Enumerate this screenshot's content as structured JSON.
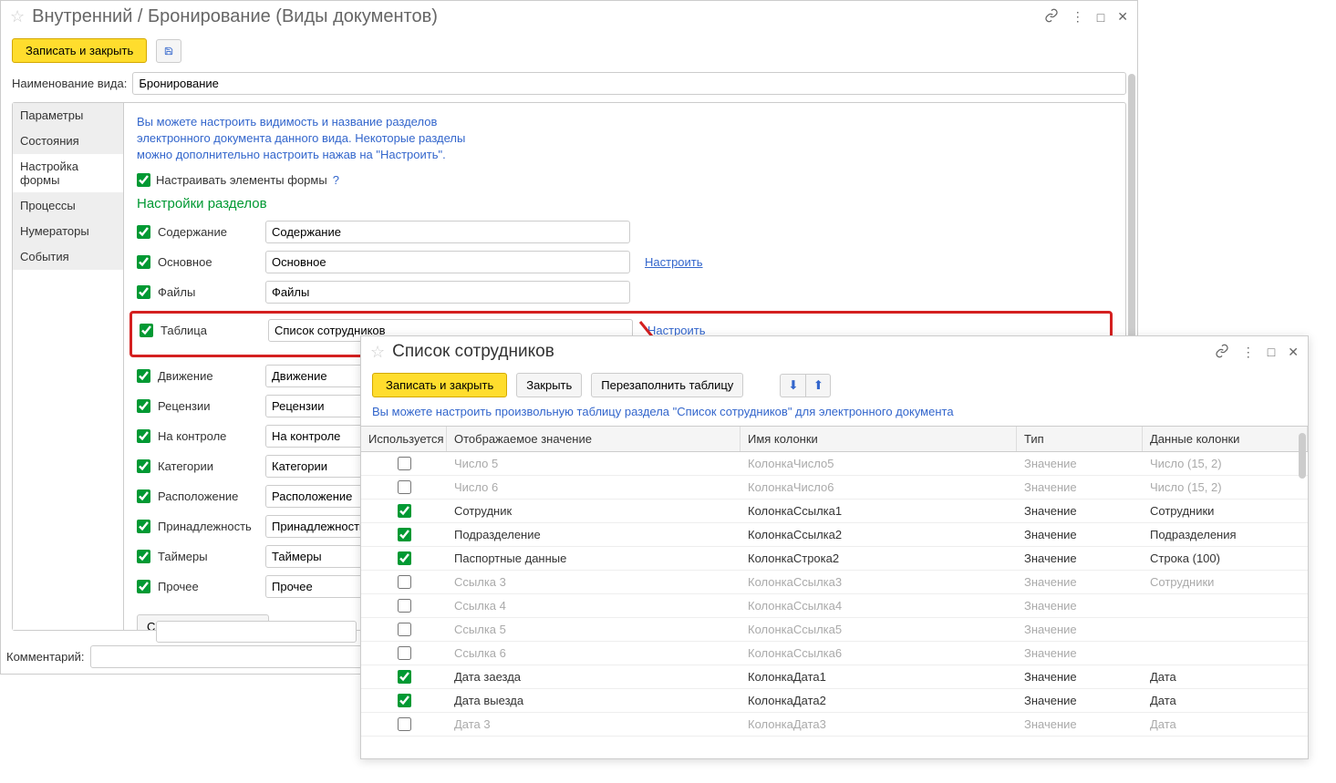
{
  "main": {
    "title": "Внутренний / Бронирование (Виды документов)",
    "save_close": "Записать и закрыть",
    "name_label": "Наименование вида:",
    "name_value": "Бронирование",
    "sidebar": [
      {
        "label": "Параметры"
      },
      {
        "label": "Состояния"
      },
      {
        "label": "Настройка формы"
      },
      {
        "label": "Процессы"
      },
      {
        "label": "Нумераторы"
      },
      {
        "label": "События"
      }
    ],
    "hint": "Вы можете настроить видимость и название разделов электронного документа данного вида. Некоторые разделы можно дополнительно настроить нажав на \"Настроить\".",
    "configure_elements": "Настраивать элементы формы",
    "help": "?",
    "sections_title": "Настройки разделов",
    "config_link": "Настроить",
    "rows": [
      {
        "label": "Содержание",
        "value": "Содержание",
        "link": false,
        "hl": false
      },
      {
        "label": "Основное",
        "value": "Основное",
        "link": true,
        "hl": false
      },
      {
        "label": "Файлы",
        "value": "Файлы",
        "link": false,
        "hl": false
      },
      {
        "label": "Таблица",
        "value": "Список сотрудников",
        "link": true,
        "hl": true
      },
      {
        "label": "Движение",
        "value": "Движение",
        "link": false,
        "hl": false
      },
      {
        "label": "Рецензии",
        "value": "Рецензии",
        "link": false,
        "hl": false
      },
      {
        "label": "На контроле",
        "value": "На контроле",
        "link": false,
        "hl": false
      },
      {
        "label": "Категории",
        "value": "Категории",
        "link": false,
        "hl": false
      },
      {
        "label": "Расположение",
        "value": "Расположение",
        "link": false,
        "hl": false
      },
      {
        "label": "Принадлежность",
        "value": "Принадлежность",
        "link": false,
        "hl": false
      },
      {
        "label": "Таймеры",
        "value": "Таймеры",
        "link": false,
        "hl": false
      },
      {
        "label": "Прочее",
        "value": "Прочее",
        "link": false,
        "hl": false
      }
    ],
    "reset": "Сбросить настройки",
    "comment_label": "Комментарий:"
  },
  "sub": {
    "title": "Список сотрудников",
    "save_close": "Записать и закрыть",
    "close": "Закрыть",
    "refill": "Перезаполнить таблицу",
    "hint": "Вы можете настроить произвольную таблицу раздела \"Список сотрудников\" для электронного документа",
    "columns": {
      "used": "Используется",
      "disp": "Отображаемое значение",
      "name": "Имя колонки",
      "type": "Тип",
      "data": "Данные колонки"
    },
    "rows": [
      {
        "used": false,
        "disp": "Число 5",
        "name": "КолонкаЧисло5",
        "type": "Значение",
        "data": "Число (15, 2)",
        "disabled": true
      },
      {
        "used": false,
        "disp": "Число 6",
        "name": "КолонкаЧисло6",
        "type": "Значение",
        "data": "Число (15, 2)",
        "disabled": true
      },
      {
        "used": true,
        "disp": "Сотрудник",
        "name": "КолонкаСсылка1",
        "type": "Значение",
        "data": "Сотрудники",
        "disabled": false
      },
      {
        "used": true,
        "disp": "Подразделение",
        "name": "КолонкаСсылка2",
        "type": "Значение",
        "data": "Подразделения",
        "disabled": false
      },
      {
        "used": true,
        "disp": "Паспортные данные",
        "name": "КолонкаСтрока2",
        "type": "Значение",
        "data": "Строка (100)",
        "disabled": false
      },
      {
        "used": false,
        "disp": "Ссылка 3",
        "name": "КолонкаСсылка3",
        "type": "Значение",
        "data": "Сотрудники",
        "disabled": true
      },
      {
        "used": false,
        "disp": "Ссылка 4",
        "name": "КолонкаСсылка4",
        "type": "Значение",
        "data": "",
        "disabled": true
      },
      {
        "used": false,
        "disp": "Ссылка 5",
        "name": "КолонкаСсылка5",
        "type": "Значение",
        "data": "",
        "disabled": true
      },
      {
        "used": false,
        "disp": "Ссылка 6",
        "name": "КолонкаСсылка6",
        "type": "Значение",
        "data": "",
        "disabled": true
      },
      {
        "used": true,
        "disp": "Дата заезда",
        "name": "КолонкаДата1",
        "type": "Значение",
        "data": "Дата",
        "disabled": false
      },
      {
        "used": true,
        "disp": "Дата выезда",
        "name": "КолонкаДата2",
        "type": "Значение",
        "data": "Дата",
        "disabled": false
      },
      {
        "used": false,
        "disp": "Дата 3",
        "name": "КолонкаДата3",
        "type": "Значение",
        "data": "Дата",
        "disabled": true
      }
    ]
  }
}
